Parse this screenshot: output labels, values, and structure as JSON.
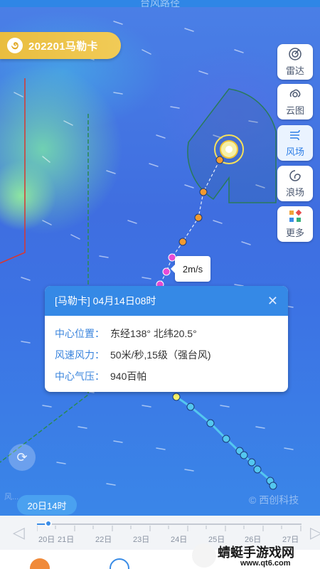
{
  "topbar": {
    "title": "台风路径"
  },
  "typhoon": {
    "chip_label": "202201马勒卡"
  },
  "tools": [
    {
      "label": "雷达",
      "icon": "radar-icon",
      "active": false
    },
    {
      "label": "云图",
      "icon": "cloud-image-icon",
      "active": false
    },
    {
      "label": "风场",
      "icon": "wind-field-icon",
      "active": true
    },
    {
      "label": "浪场",
      "icon": "wave-field-icon",
      "active": false
    },
    {
      "label": "更多",
      "icon": "more-apps-icon",
      "active": false
    }
  ],
  "speed_bubble": "2m/s",
  "info_card": {
    "title": "[马勒卡] 04月14日08时",
    "close": "✕",
    "rows": [
      {
        "key": "中心位置：",
        "value": "东经138°   北纬20.5°"
      },
      {
        "key": "风速风力：",
        "value": "50米/秒,15级（强台风)"
      },
      {
        "key": "中心气压：",
        "value": "940百帕"
      }
    ]
  },
  "map": {
    "watermark": "© 西创科技",
    "left_note": "风...",
    "time_chip": "20日14时"
  },
  "timeline": {
    "dates": [
      "20日",
      "21日",
      "22日",
      "23日",
      "24日",
      "25日",
      "26日",
      "27日"
    ]
  },
  "brand": {
    "name": "蜻蜓手游戏网",
    "url": "www.qt6.com"
  },
  "colors": {
    "accent": "#3589e6",
    "chip": "#efc550"
  }
}
